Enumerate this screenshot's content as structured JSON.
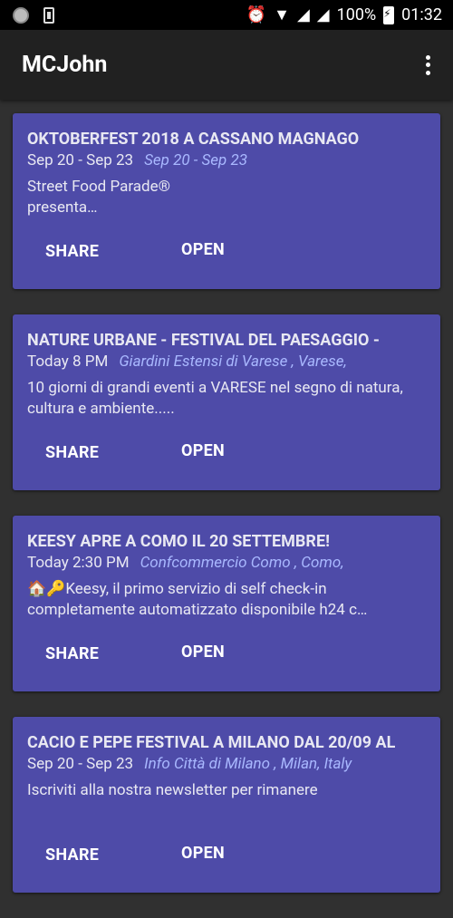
{
  "status_bar": {
    "battery": "100%",
    "time": "01:32",
    "icons": [
      "circle-icon",
      "sim-icon",
      "alarm-icon",
      "wifi-icon",
      "signal-icon",
      "signal-icon",
      "battery-charging-icon"
    ]
  },
  "app_bar": {
    "title": "MCJohn",
    "menu_icon": "more-vert-icon"
  },
  "events": [
    {
      "title": "OKTOBERFEST 2018 A CASSANO MAGNAGO",
      "date": "Sep 20 - Sep 23",
      "place": "Sep 20 - Sep 23",
      "description": "Street Food Parade®\npresenta…",
      "share_label": "SHARE",
      "open_label": "OPEN"
    },
    {
      "title": "NATURE URBANE - FESTIVAL DEL PAESAGGIO -",
      "date": "Today 8 PM",
      "place": "Giardini Estensi di Varese , Varese,",
      "description": "10 giorni di grandi eventi a VARESE nel segno di natura, cultura e ambiente.....",
      "share_label": "SHARE",
      "open_label": "OPEN"
    },
    {
      "title": "KEESY APRE A COMO IL 20 SETTEMBRE!",
      "date": "Today 2:30 PM",
      "place": "Confcommercio Como , Como,",
      "description": "🏠🔑Keesy, il primo servizio di self check-in completamente automatizzato disponibile h24 c…",
      "share_label": "SHARE",
      "open_label": "OPEN"
    },
    {
      "title": "CACIO E PEPE FESTIVAL A MILANO DAL 20/09 AL",
      "date": "Sep 20 - Sep 23",
      "place": "Info Città di Milano , Milan, Italy",
      "description": "Iscriviti alla nostra newsletter per rimanere",
      "share_label": "SHARE",
      "open_label": "OPEN"
    }
  ],
  "colors": {
    "card_bg": "#4e4ba8",
    "place_text": "#a9b8ff",
    "app_bar_bg": "#212121",
    "page_bg": "#303030"
  }
}
